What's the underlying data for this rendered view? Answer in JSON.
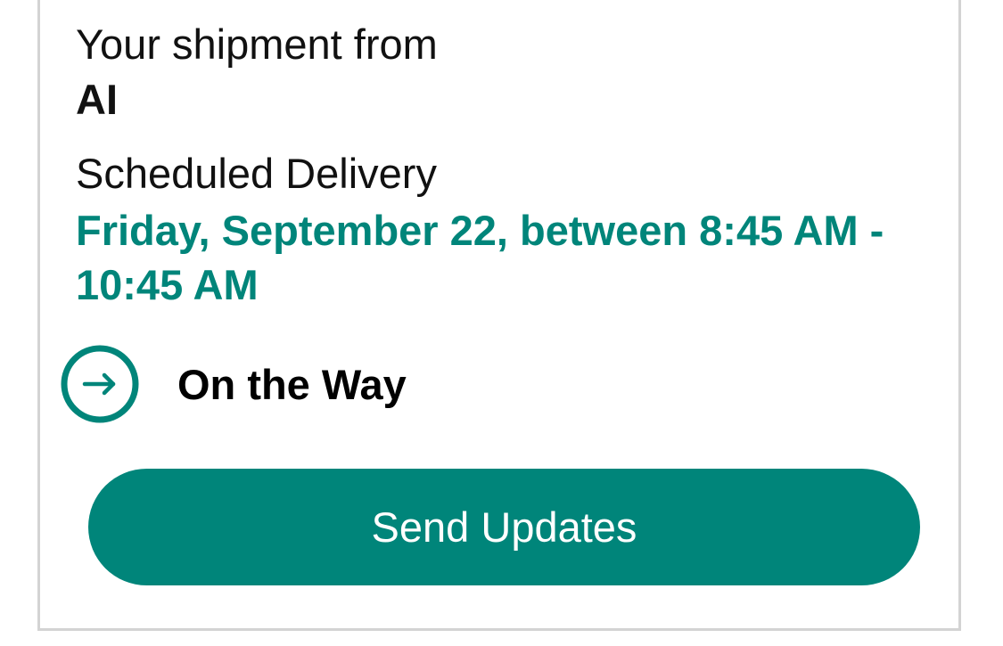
{
  "shipment": {
    "from_label": "Your shipment from",
    "shipper_name": "AI"
  },
  "delivery": {
    "label": "Scheduled Delivery",
    "window": "Friday, September 22, between 8:45 AM - 10:45 AM"
  },
  "status": {
    "icon": "arrow-right-circle-icon",
    "label": "On the Way"
  },
  "actions": {
    "send_updates_label": "Send Updates"
  },
  "colors": {
    "accent": "#00857a",
    "text": "#111111",
    "card_border": "#d3d3d3"
  }
}
